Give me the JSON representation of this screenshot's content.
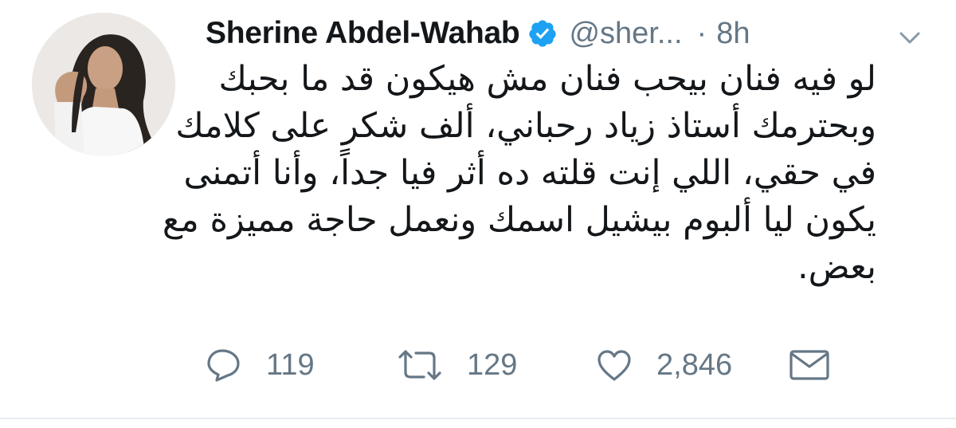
{
  "tweet": {
    "author_name": "Sherine Abdel-Wahab",
    "handle": "@sher...",
    "separator": "·",
    "time": "8h",
    "verified": true,
    "text_lines": [
      "لو فيه فنان بيحب فنان مش هيكون قد ما بحبك",
      "وبحترمك أستاذ زياد رحباني، ألف شكر على كلامك",
      "في حقي، اللي إنت قلته ده أثر فيا جداً، وأنا أتمنى",
      "يكون ليا ألبوم بيشيل اسمك ونعمل حاجة مميزة مع",
      "بعض."
    ]
  },
  "actions": {
    "replies": "119",
    "retweets": "129",
    "likes": "2,846"
  },
  "icons": {
    "verified": "verified-badge-icon",
    "menu": "chevron-down-icon",
    "reply": "reply-icon",
    "retweet": "retweet-icon",
    "like": "heart-icon",
    "dm": "envelope-icon"
  },
  "colors": {
    "text": "#14171a",
    "secondary": "#657786",
    "verified": "#1da1f2",
    "divider": "#e6ecf0"
  }
}
